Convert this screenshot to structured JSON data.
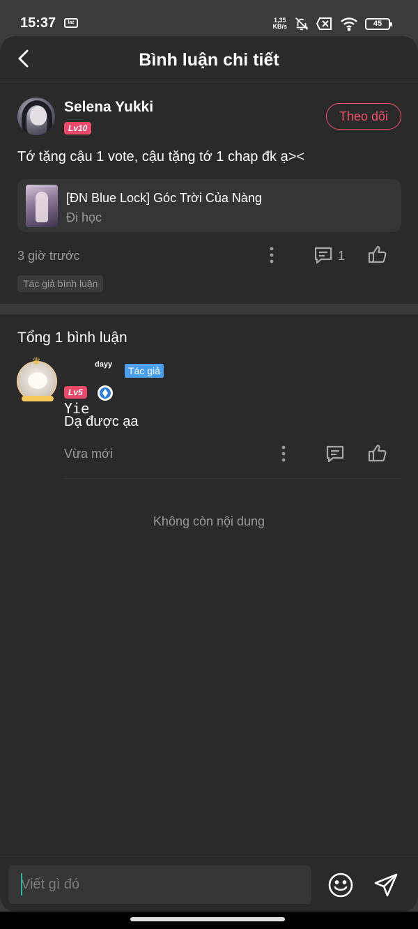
{
  "status_bar": {
    "time": "15:37",
    "laz_label": "laz",
    "speed_top": "1,35",
    "speed_bottom": "KB/s",
    "battery": "45"
  },
  "header": {
    "title": "Bình luận chi tiết"
  },
  "comment": {
    "user_name": "Selena Yukki",
    "level": "Lv10",
    "follow_label": "Theo dõi",
    "text": "Tớ tặng cậu 1 vote, cậu tặng tớ 1 chap đk ạ><",
    "book": {
      "title": "[ĐN Blue Lock] Góc Trời Của Nàng",
      "chapter": "Đi học"
    },
    "time": "3 giờ trước",
    "reply_count": "1",
    "author_chip": "Tác giả bình luận"
  },
  "replies": {
    "total_label": "Tổng 1 bình luận",
    "items": [
      {
        "user_name": "Yie",
        "name_sup": "dayy",
        "author_tag": "Tác giả",
        "level": "Lv5",
        "text": "Dạ được ạa",
        "time": "Vừa mới"
      }
    ],
    "end_label": "Không còn nội dung"
  },
  "input": {
    "placeholder": "Viết gì đó"
  },
  "colors": {
    "background": "#2a2a2a",
    "accent_pink": "#f0506e",
    "level_badge": "#ec4a6a",
    "author_tag_blue": "#4aa0f0",
    "muted_text": "#9a9a9a"
  },
  "icons": {
    "back": "chevron-left-icon",
    "more": "more-vertical-icon",
    "comment": "comment-icon",
    "like": "thumbs-up-icon",
    "emoji": "emoji-icon",
    "send": "send-icon"
  }
}
